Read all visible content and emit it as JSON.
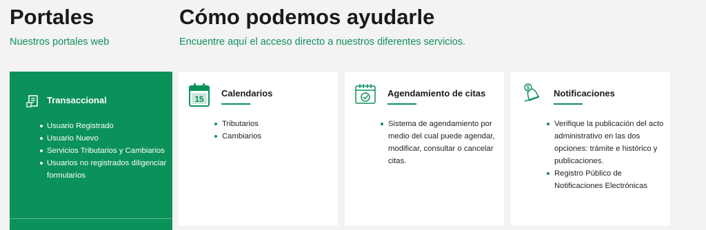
{
  "portales": {
    "title": "Portales",
    "subtitle": "Nuestros portales web"
  },
  "ayuda": {
    "title": "Cómo podemos ayudarle",
    "subtitle": "Encuentre aquí el acceso directo a nuestros diferentes servicios."
  },
  "transaccional": {
    "title": "Transaccional",
    "icon": "document-form-icon",
    "items": [
      "Usuario Registrado",
      "Usuario Nuevo",
      "Servicios Tributarios y Cambiarios",
      "Usuarios no registrados diligenciar formularios"
    ]
  },
  "cards": [
    {
      "title": "Calendarios",
      "icon": "calendar-15-icon",
      "calendar_day": "15",
      "items": [
        "Tributarios",
        "Cambiarios"
      ]
    },
    {
      "title": "Agendamiento de citas",
      "icon": "calendar-check-icon",
      "items": [
        "Sistema de agendamiento por medio del cual puede agendar, modificar, consultar o cancelar citas."
      ]
    },
    {
      "title": "Notificaciones",
      "icon": "bell-icon",
      "items": [
        "Verifique la publicación del acto administrativo en las dos opciones: trámite e histórico y publicaciones.",
        "Registro Público de Notificaciones Electrónicas"
      ]
    }
  ],
  "colors": {
    "brand_green": "#0b915a",
    "background": "#f3f3f3"
  }
}
